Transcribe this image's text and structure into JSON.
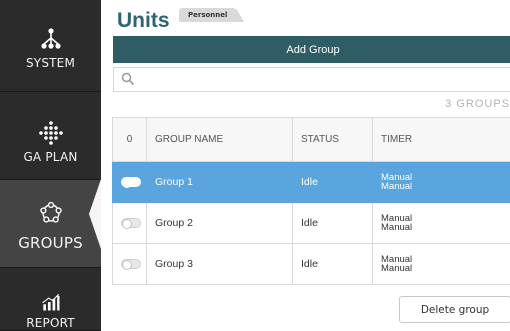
{
  "sidebar": {
    "items": [
      {
        "label": "SYSTEM",
        "icon": "network-tree-icon",
        "active": false
      },
      {
        "label": "GA PLAN",
        "icon": "grid-dots-icon",
        "active": false
      },
      {
        "label": "GROUPS",
        "icon": "group-ring-icon",
        "active": true
      },
      {
        "label": "REPORT",
        "icon": "bar-chart-icon",
        "active": false
      }
    ]
  },
  "header": {
    "title": "Units",
    "tab_personnel": "Personnel"
  },
  "toolbar": {
    "add_group_label": "Add Group"
  },
  "search": {
    "placeholder": "",
    "value": ""
  },
  "summary": {
    "group_count_label": "3 GROUPS"
  },
  "table": {
    "columns": [
      "0",
      "GROUP NAME",
      "STATUS",
      "TIMER"
    ],
    "rows": [
      {
        "name": "Group 1",
        "status": "Idle",
        "timer_line1": "Manual",
        "timer_line2": "Manual",
        "selected": true
      },
      {
        "name": "Group 2",
        "status": "Idle",
        "timer_line1": "Manual",
        "timer_line2": "Manual",
        "selected": false
      },
      {
        "name": "Group 3",
        "status": "Idle",
        "timer_line1": "Manual",
        "timer_line2": "Manual",
        "selected": false
      }
    ]
  },
  "footer": {
    "delete_label": "Delete group"
  },
  "colors": {
    "sidebar_bg": "#2b2b2b",
    "sidebar_active_bg": "#444444",
    "accent": "#2f5d66",
    "title": "#2f6273",
    "selected_row": "#5aa5dd"
  }
}
